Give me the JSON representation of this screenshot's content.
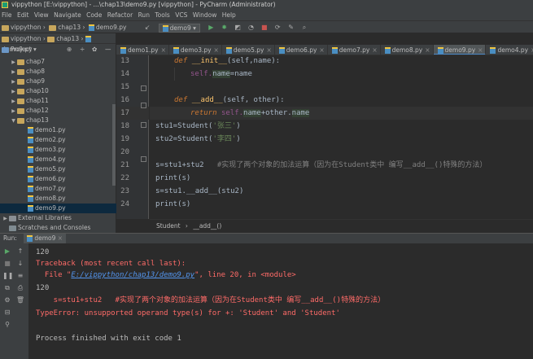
{
  "window": {
    "title": "vippython [E:\\vippython] - ...\\chap13\\demo9.py [vippython] - PyCharm (Administrator)"
  },
  "menu": [
    "File",
    "Edit",
    "View",
    "Navigate",
    "Code",
    "Refactor",
    "Run",
    "Tools",
    "VCS",
    "Window",
    "Help"
  ],
  "toolbar": {
    "breadcrumb": [
      "vippython",
      "chap13",
      "demo9.py"
    ],
    "run_config": "demo9"
  },
  "project_panel": {
    "label": "Project",
    "root": "vippython"
  },
  "tree": [
    {
      "label": "chap7",
      "type": "folder",
      "expanded": false
    },
    {
      "label": "chap8",
      "type": "folder",
      "expanded": false
    },
    {
      "label": "chap9",
      "type": "folder",
      "expanded": false
    },
    {
      "label": "chap10",
      "type": "folder",
      "expanded": false
    },
    {
      "label": "chap11",
      "type": "folder",
      "expanded": false
    },
    {
      "label": "chap12",
      "type": "folder",
      "expanded": false
    },
    {
      "label": "chap13",
      "type": "folder",
      "expanded": true
    },
    {
      "label": "demo1.py",
      "type": "file"
    },
    {
      "label": "demo2.py",
      "type": "file"
    },
    {
      "label": "demo3.py",
      "type": "file"
    },
    {
      "label": "demo4.py",
      "type": "file"
    },
    {
      "label": "demo5.py",
      "type": "file"
    },
    {
      "label": "demo6.py",
      "type": "file"
    },
    {
      "label": "demo7.py",
      "type": "file"
    },
    {
      "label": "demo8.py",
      "type": "file"
    },
    {
      "label": "demo9.py",
      "type": "file",
      "selected": true
    },
    {
      "label": "External Libraries",
      "type": "lib"
    },
    {
      "label": "Scratches and Consoles",
      "type": "scratch"
    }
  ],
  "tabs": [
    {
      "label": "demo1.py"
    },
    {
      "label": "demo3.py"
    },
    {
      "label": "demo5.py"
    },
    {
      "label": "demo6.py"
    },
    {
      "label": "demo7.py"
    },
    {
      "label": "demo8.py"
    },
    {
      "label": "demo9.py",
      "active": true
    },
    {
      "label": "demo4.py"
    }
  ],
  "editor": {
    "line_numbers": [
      "13",
      "14",
      "15",
      "16",
      "17",
      "18",
      "19",
      "20",
      "21",
      "22",
      "23",
      "24"
    ],
    "code": {
      "l13_def": "def ",
      "l13_fn": "__init__",
      "l13_rest": "(self,name):",
      "l14_self": "self.",
      "l14_name": "name",
      "l14_rest": "=name",
      "l16_def": "def ",
      "l16_fn": "__add__",
      "l16_rest": "(self, other):",
      "l17_ret": "return ",
      "l17_self": "self.",
      "l17_name": "name",
      "l17_plus": "+other.",
      "l17_name2": "name",
      "l18_pre": "stu1=Student(",
      "l18_str": "'张三'",
      "l18_post": ")",
      "l19_pre": "stu2=Student(",
      "l19_str": "'李四'",
      "l19_post": ")",
      "l21_code": "s=stu1+stu2   ",
      "l21_cm": "#实现了两个对象的加法运算（因为在Student类中 编写__add__()特殊的方法）",
      "l22": "print(s)",
      "l23": "s=stu1.__add__(stu2)",
      "l24": "print(s)"
    }
  },
  "editor_breadcrumb": {
    "cls": "Student",
    "sep": "›",
    "method": "__add__()"
  },
  "run_panel": {
    "label": "Run:",
    "config": "demo9"
  },
  "console": {
    "l1": "120",
    "l2": "Traceback (most recent call last):",
    "l3_pre": "  File \"",
    "l3_link": "E:/vippython/chap13/demo9.py",
    "l3_post": "\", line 20, in <module>",
    "l4": "120",
    "l5": "    s=stu1+stu2   #实现了两个对象的加法运算（因为在Student类中 编写__add__()特殊的方法）",
    "l6": "TypeError: unsupported operand type(s) for +: 'Student' and 'Student'",
    "l7": "Process finished with exit code 1"
  }
}
